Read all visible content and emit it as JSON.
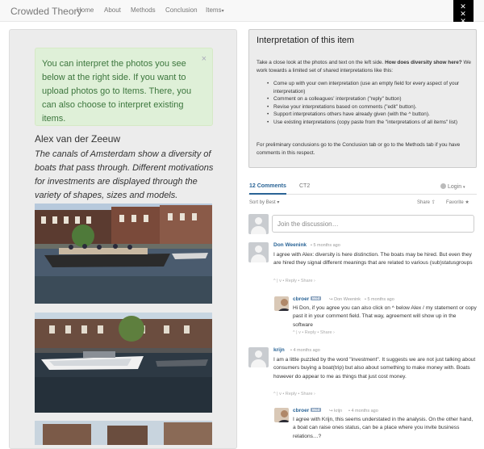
{
  "navbar": {
    "brand": "Crowded Theory",
    "items": [
      "Home",
      "About",
      "Methods",
      "Conclusion",
      "Items"
    ],
    "logo": "XXX"
  },
  "left": {
    "alert_text": "You can interpret the photos you see below at the right side. If you want to upload photos go to Items. There, you can also choose to interpret existing items.",
    "alert_close": "×",
    "author": "Alex van der Zeeuw",
    "intro": "The canals of Amsterdam show a diversity of boats that pass through. Different motivations for investments are displayed through the variety of shapes, sizes and models."
  },
  "right": {
    "title": "Interpretation of this item",
    "para1_a": "Take a close look at the photos and text on the left side. ",
    "para1_bold": "How does diversity show here?",
    "para1_b": " We work towards a limited set of shared interpretations like this:",
    "bullets": [
      "Come up with your own interpretation (use an empty field for every aspect of your interpretation)",
      "Comment on a colleagues' interpretation (\"reply\" button)",
      "Revise your interpretations based on comments (\"edit\" button).",
      "Support interpretations others have already given (with the ^ button).",
      "Use existing interpretations (copy paste from the \"interpretations of all items\" list)"
    ],
    "para2": "For preliminary conclusions go to the Conclusion tab or go to the Methods tab if you have comments in this respect."
  },
  "comments": {
    "tab_active": "12 Comments",
    "tab_other": "CT2",
    "login": "Login",
    "sort": "Sort by Best",
    "share": "Share",
    "favorite": "Favorite",
    "placeholder": "Join the discussion…",
    "items": [
      {
        "name": "Don Weenink",
        "time": "• 5 months ago",
        "text": "I agree with Alex: diversity is here distinction. The boats may be hired. But even they are hired they signal different meanings that are related to various (sub)statusgroups",
        "actions": "^ | v • Reply • Share ›"
      },
      {
        "name": "cbroer",
        "badge": "Mod",
        "reply_to": "Don Weenink",
        "time": "• 5 months ago",
        "text": "Hi Don, if you agree you can also click on ^ below Alex / my statement or copy past it in your comment field. That way, agreement will show up in the software",
        "actions": "^ | v • Reply • Share ›"
      },
      {
        "name": "krijn",
        "time": "• 4 months ago",
        "text": "I am a little puzzled by the word \"investment\". It suggests we are not just talking about consumers buying a boat(trip) but also about something to make money with. Boats however do appear to me as things that just cost money.",
        "actions": "^ | v • Reply • Share ›"
      },
      {
        "name": "cbroer",
        "badge": "Mod",
        "reply_to": "krijn",
        "time": "• 4 months ago",
        "text": "I agree with Krijn, this seems understated in the analysis. On the other hand, a boat can raise ones status, can be a place where you invite business relations…?",
        "actions": ""
      }
    ]
  },
  "colors": {
    "alert_bg": "#dff0d8",
    "alert_text": "#3c763d",
    "link": "#2a6496"
  }
}
